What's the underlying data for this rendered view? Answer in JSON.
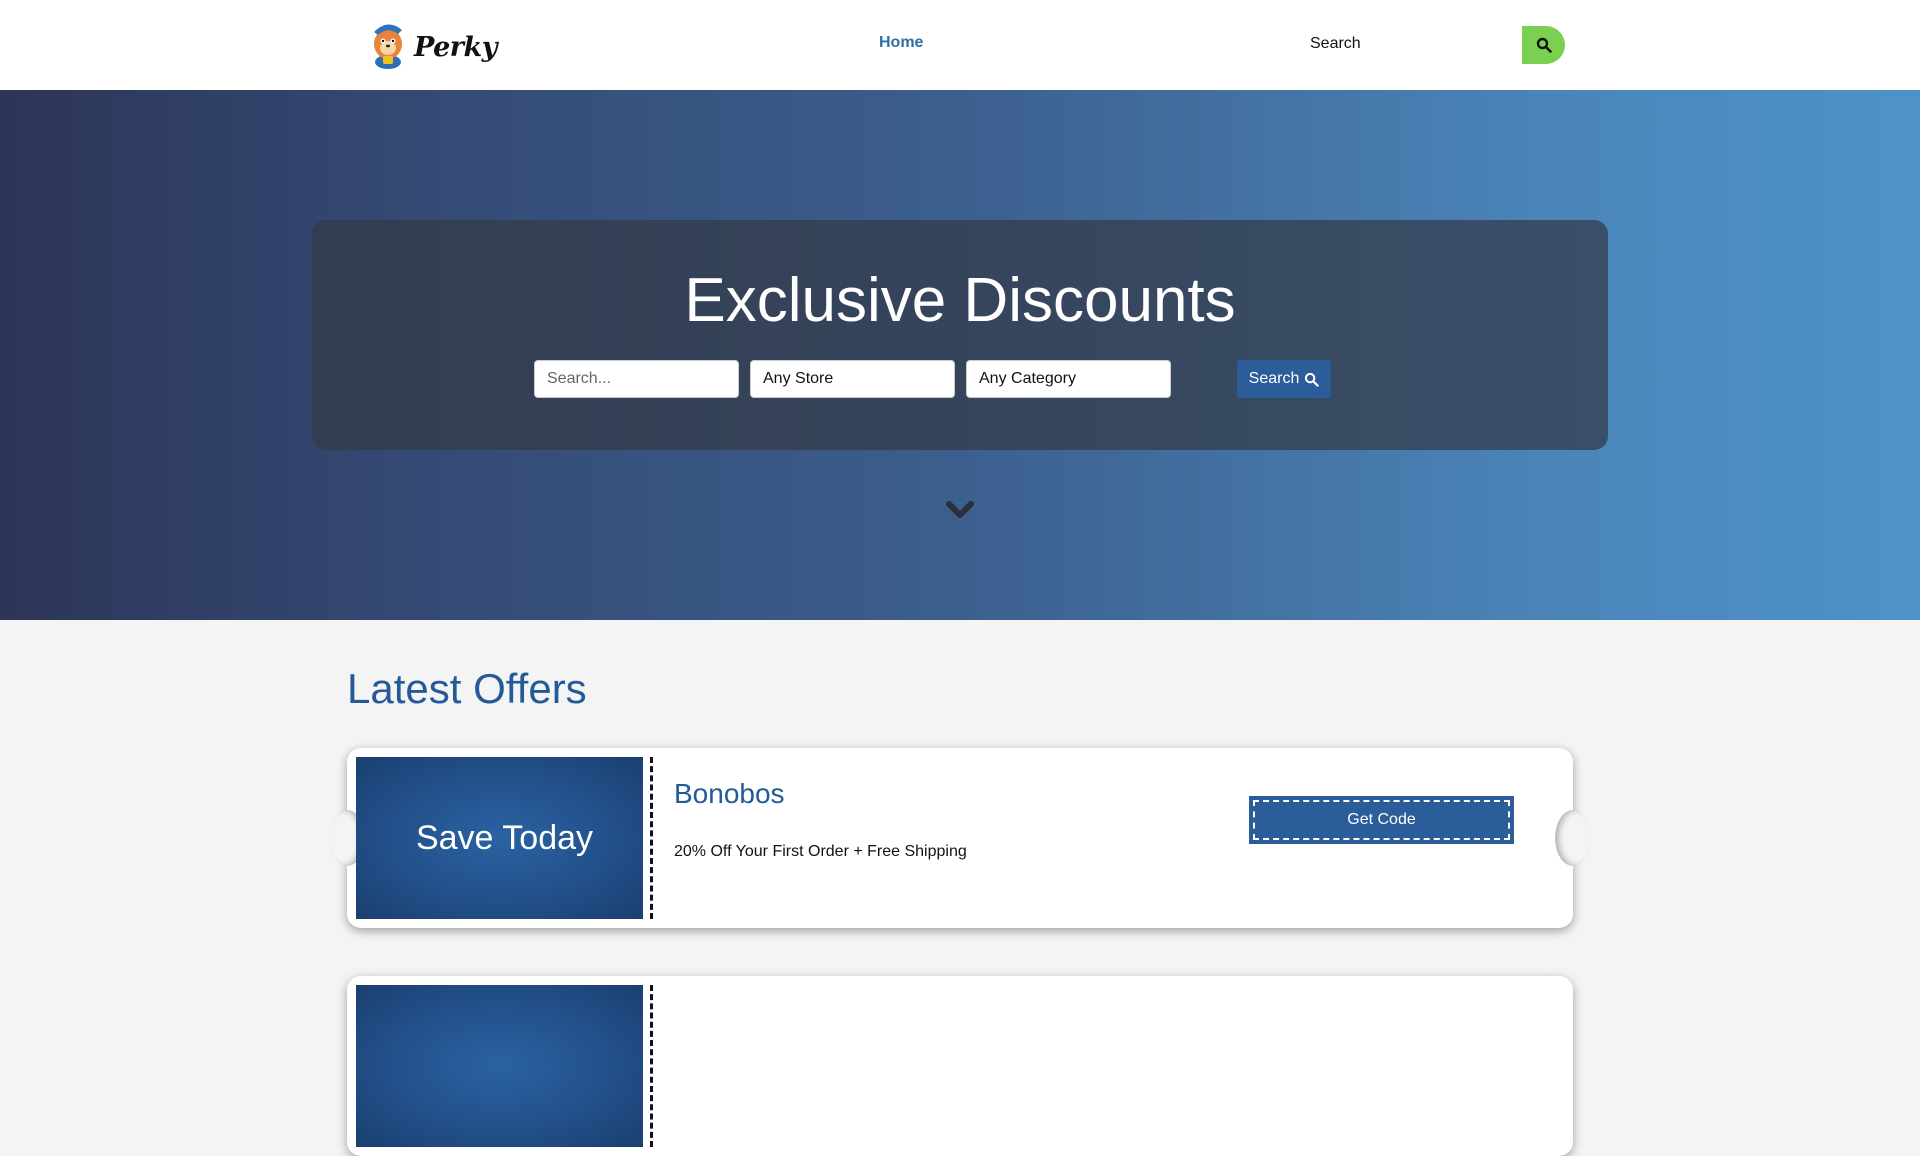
{
  "header": {
    "logo_text": "Perky",
    "nav_home": "Home",
    "search_placeholder": "Search",
    "accent_color": "#7ad04f"
  },
  "hero": {
    "title": "Exclusive Discounts",
    "search_placeholder": "Search...",
    "store_value": "Any Store",
    "category_value": "Any Category",
    "search_button": "Search"
  },
  "offers": {
    "heading": "Latest Offers",
    "items": [
      {
        "badge": "Save Today",
        "store": "Bonobos",
        "description": "20% Off Your First Order + Free Shipping",
        "button": "Get Code"
      },
      {
        "badge": "",
        "store": "",
        "description": "",
        "button": ""
      }
    ]
  },
  "colors": {
    "brand_blue": "#2b5d9a",
    "heading_blue": "#235a97",
    "nav_link": "#2f6fa3"
  }
}
